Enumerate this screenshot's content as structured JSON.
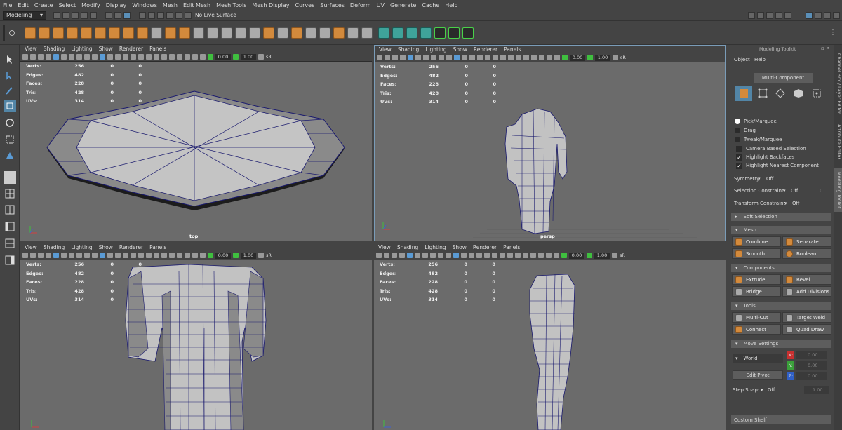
{
  "menubar": {
    "items": [
      "File",
      "Edit",
      "Create",
      "Select",
      "Modify",
      "Display",
      "Windows",
      "Mesh",
      "Edit Mesh",
      "Mesh Tools",
      "Mesh Display",
      "Curves",
      "Surfaces",
      "Deform",
      "UV",
      "Generate",
      "Cache",
      "Help"
    ]
  },
  "statusline": {
    "menuset": "Modeling",
    "live_surface": "No Live Surface"
  },
  "viewports": [
    {
      "menus": [
        "View",
        "Shading",
        "Lighting",
        "Show",
        "Renderer",
        "Panels"
      ],
      "camera": "top",
      "field_a": "0.00",
      "field_b": "1.00",
      "sr": "sR"
    },
    {
      "menus": [
        "View",
        "Shading",
        "Lighting",
        "Show",
        "Renderer",
        "Panels"
      ],
      "camera": "persp",
      "field_a": "0.00",
      "field_b": "1.00",
      "sr": "sR"
    },
    {
      "menus": [
        "View",
        "Shading",
        "Lighting",
        "Show",
        "Renderer",
        "Panels"
      ],
      "camera": "",
      "field_a": "0.00",
      "field_b": "1.00",
      "sr": "sR"
    },
    {
      "menus": [
        "View",
        "Shading",
        "Lighting",
        "Show",
        "Renderer",
        "Panels"
      ],
      "camera": "",
      "field_a": "0.00",
      "field_b": "1.00",
      "sr": "sR"
    }
  ],
  "hud": [
    {
      "label": "Verts:",
      "a": "256",
      "b": "0",
      "c": "0"
    },
    {
      "label": "Edges:",
      "a": "482",
      "b": "0",
      "c": "0"
    },
    {
      "label": "Faces:",
      "a": "228",
      "b": "0",
      "c": "0"
    },
    {
      "label": "Tris:",
      "a": "428",
      "b": "0",
      "c": "0"
    },
    {
      "label": "UVs:",
      "a": "314",
      "b": "0",
      "c": "0"
    }
  ],
  "toolkit": {
    "title": "Modeling Toolkit",
    "menu_object": "Object",
    "menu_help": "Help",
    "mode": "Multi-Component",
    "pick_marquee": "Pick/Marquee",
    "drag": "Drag",
    "tweak_marquee": "Tweak/Marquee",
    "camera_based": "Camera Based Selection",
    "highlight_backfaces": "Highlight Backfaces",
    "highlight_nearest": "Highlight Nearest Component",
    "symmetry_label": "Symmetry",
    "symmetry_value": "Off",
    "selection_constraint_label": "Selection Constraint",
    "selection_constraint_value": "Off",
    "selection_constraint_num": "0",
    "transform_constraint_label": "Transform Constraint",
    "transform_constraint_value": "Off",
    "soft_selection": "Soft Selection",
    "mesh_section": "Mesh",
    "combine": "Combine",
    "separate": "Separate",
    "smooth": "Smooth",
    "boolean": "Boolean",
    "components_section": "Components",
    "extrude": "Extrude",
    "bevel": "Bevel",
    "bridge": "Bridge",
    "add_divisions": "Add Divisions",
    "tools_section": "Tools",
    "multi_cut": "Multi-Cut",
    "target_weld": "Target Weld",
    "connect": "Connect",
    "quad_draw": "Quad Draw",
    "move_settings": "Move Settings",
    "space": "World",
    "edit_pivot": "Edit Pivot",
    "x_label": "X:",
    "y_label": "Y:",
    "z_label": "Z:",
    "x_value": "0.00",
    "y_value": "0.00",
    "z_value": "0.00",
    "step_snap_label": "Step Snap:",
    "step_snap_value": "Off",
    "step_snap_num": "1.00",
    "custom_shelf": "Custom Shelf"
  },
  "side_tabs": {
    "channel_box": "Channel Box / Layer Editor",
    "attribute_editor": "Attribute Editor",
    "modeling_toolkit": "Modeling Toolkit"
  },
  "colors": {
    "poly_orange": "#d38a3c",
    "selection_blue": "#5285a6",
    "wire_blue": "#1a1a6e",
    "mesh_fill": "#bdbdbd",
    "viewport_bg": "#6b6b6b"
  }
}
